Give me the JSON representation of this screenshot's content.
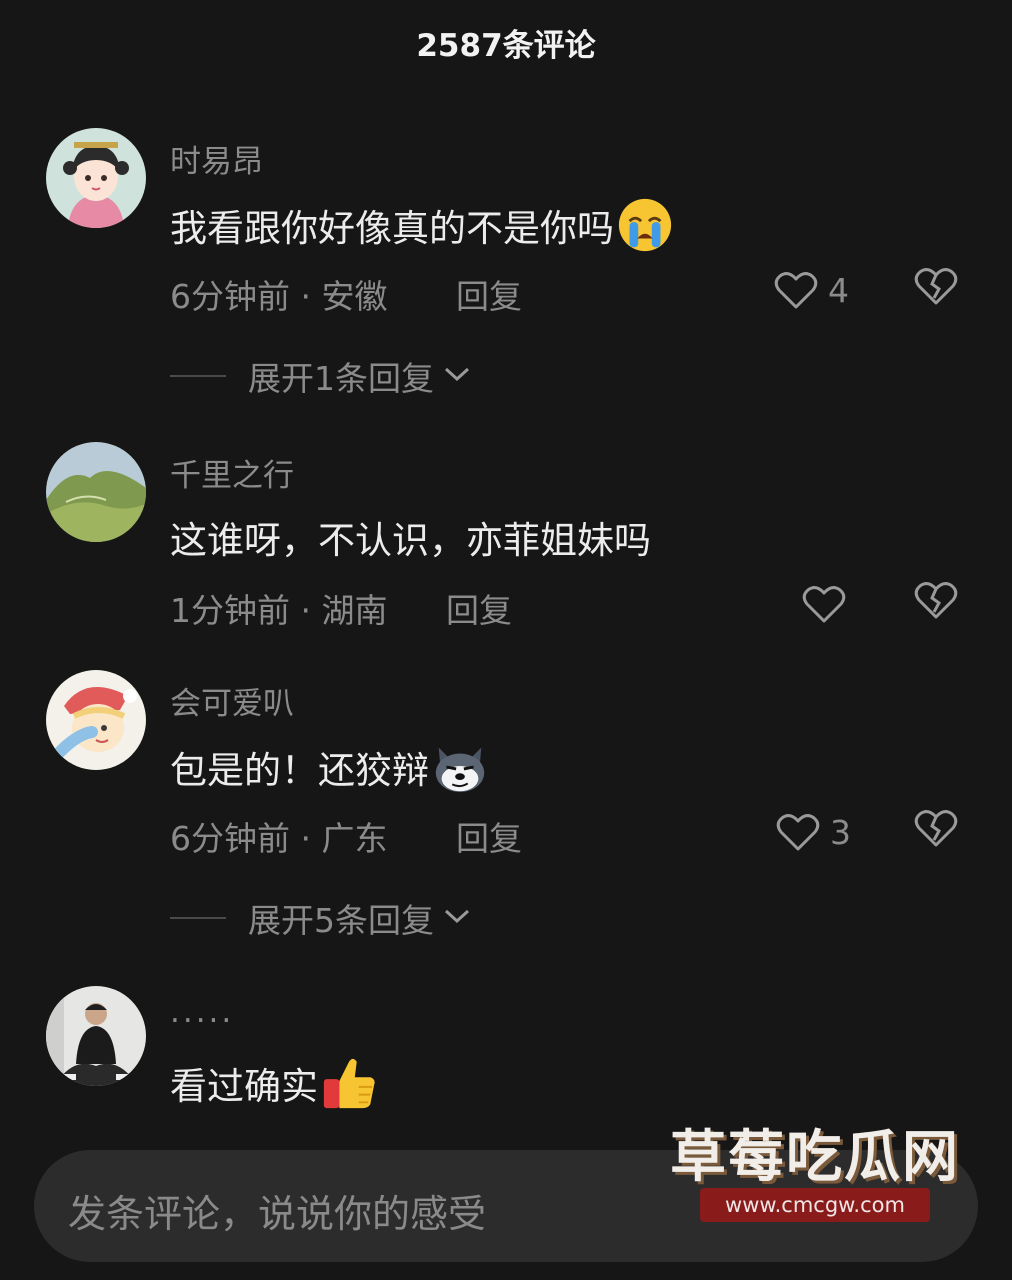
{
  "header": {
    "title": "2587条评论"
  },
  "comments": [
    {
      "username": "时易昂",
      "text": "我看跟你好像真的不是你吗",
      "emoji": "loudly-crying-face",
      "time": "6分钟前 · 安徽",
      "reply_label": "回复",
      "like_count": "4",
      "expand_label": "展开1条回复"
    },
    {
      "username": "千里之行",
      "text": "这谁呀，不认识，亦菲姐妹吗",
      "time": "1分钟前 · 湖南",
      "reply_label": "回复",
      "like_count": ""
    },
    {
      "username": "会可爱叭",
      "text": "包是的！还狡辩",
      "emoji": "smug-husky-face",
      "time": "6分钟前 · 广东",
      "reply_label": "回复",
      "like_count": "3",
      "expand_label": "展开5条回复"
    },
    {
      "username": ".....",
      "text": "看过确实",
      "emoji": "thumbs-up"
    }
  ],
  "comment_input": {
    "placeholder": "发条评论，说说你的感受"
  },
  "watermark": {
    "title": "草莓吃瓜网",
    "url": "www.cmcgw.com"
  },
  "icons": {
    "like": "heart-outline-icon",
    "dislike": "broken-heart-icon",
    "expand": "chevron-down-icon"
  },
  "colors": {
    "background": "#161616",
    "text_primary": "#ececec",
    "text_secondary": "#8b8b8b",
    "input_background": "#2c2c2c"
  }
}
